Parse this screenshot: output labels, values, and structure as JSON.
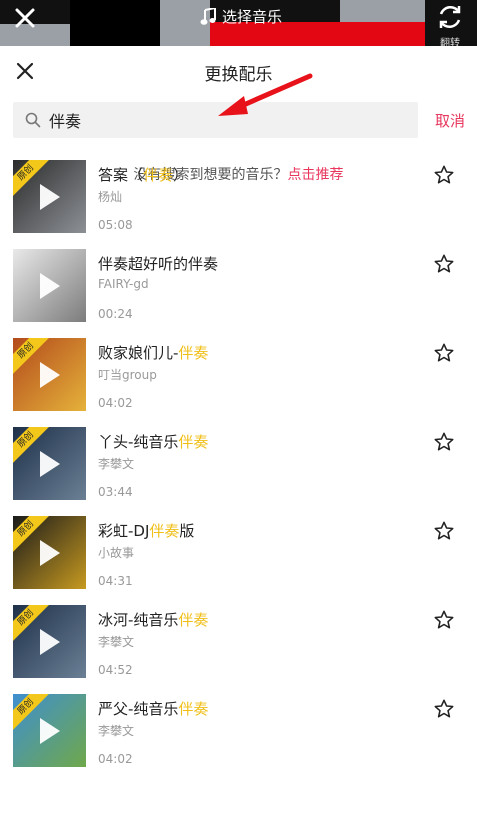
{
  "topbar": {
    "title": "选择音乐",
    "flip_label": "翻转"
  },
  "sheet": {
    "title": "更换配乐"
  },
  "search": {
    "value": "伴奏",
    "cancel_label": "取消"
  },
  "hint": {
    "text": "没有搜索到想要的音乐？",
    "link": "点击推荐"
  },
  "songs": [
    {
      "title_pre": "答案（",
      "title_hl": "伴奏",
      "title_post": "）",
      "artist": "杨灿",
      "duration": "05:08",
      "badge": "原创",
      "cover_colors": [
        "#2b2b2b",
        "#8d9196"
      ]
    },
    {
      "title_pre": "伴奏超好听的伴奏",
      "title_hl": "",
      "title_post": "",
      "artist": "FAIRY-gd",
      "duration": "00:24",
      "badge": "",
      "cover_colors": [
        "#e9e9e9",
        "#7c7c7c"
      ]
    },
    {
      "title_pre": "败家娘们儿-",
      "title_hl": "伴奏",
      "title_post": "",
      "artist": "叮当group",
      "duration": "04:02",
      "badge": "原创",
      "cover_colors": [
        "#b34a1c",
        "#e5b23a"
      ]
    },
    {
      "title_pre": "丫头-纯音乐",
      "title_hl": "伴奏",
      "title_post": "",
      "artist": "李攀文",
      "duration": "03:44",
      "badge": "原创",
      "cover_colors": [
        "#1e3149",
        "#6b7f95"
      ]
    },
    {
      "title_pre": "彩虹-DJ",
      "title_hl": "伴奏",
      "title_post": "版",
      "artist": "小故事",
      "duration": "04:31",
      "badge": "原创",
      "cover_colors": [
        "#1a1a1a",
        "#c79a20"
      ]
    },
    {
      "title_pre": "冰河-纯音乐",
      "title_hl": "伴奏",
      "title_post": "",
      "artist": "李攀文",
      "duration": "04:52",
      "badge": "原创",
      "cover_colors": [
        "#1e3149",
        "#6b7f95"
      ]
    },
    {
      "title_pre": "严父-纯音乐",
      "title_hl": "伴奏",
      "title_post": "",
      "artist": "李攀文",
      "duration": "04:02",
      "badge": "原创",
      "cover_colors": [
        "#3f8fd0",
        "#6fa84a"
      ]
    }
  ],
  "colors": {
    "accent": "#e8365d",
    "highlight": "#f0bf18",
    "badge": "#f3c81a",
    "arrow": "#e8121a"
  },
  "icons": {
    "top_close": "close-icon",
    "music": "music-note-icon",
    "flip": "flip-camera-icon",
    "sheet_close": "close-icon",
    "search": "search-icon",
    "favorite": "star-outline-icon",
    "play": "play-icon"
  }
}
